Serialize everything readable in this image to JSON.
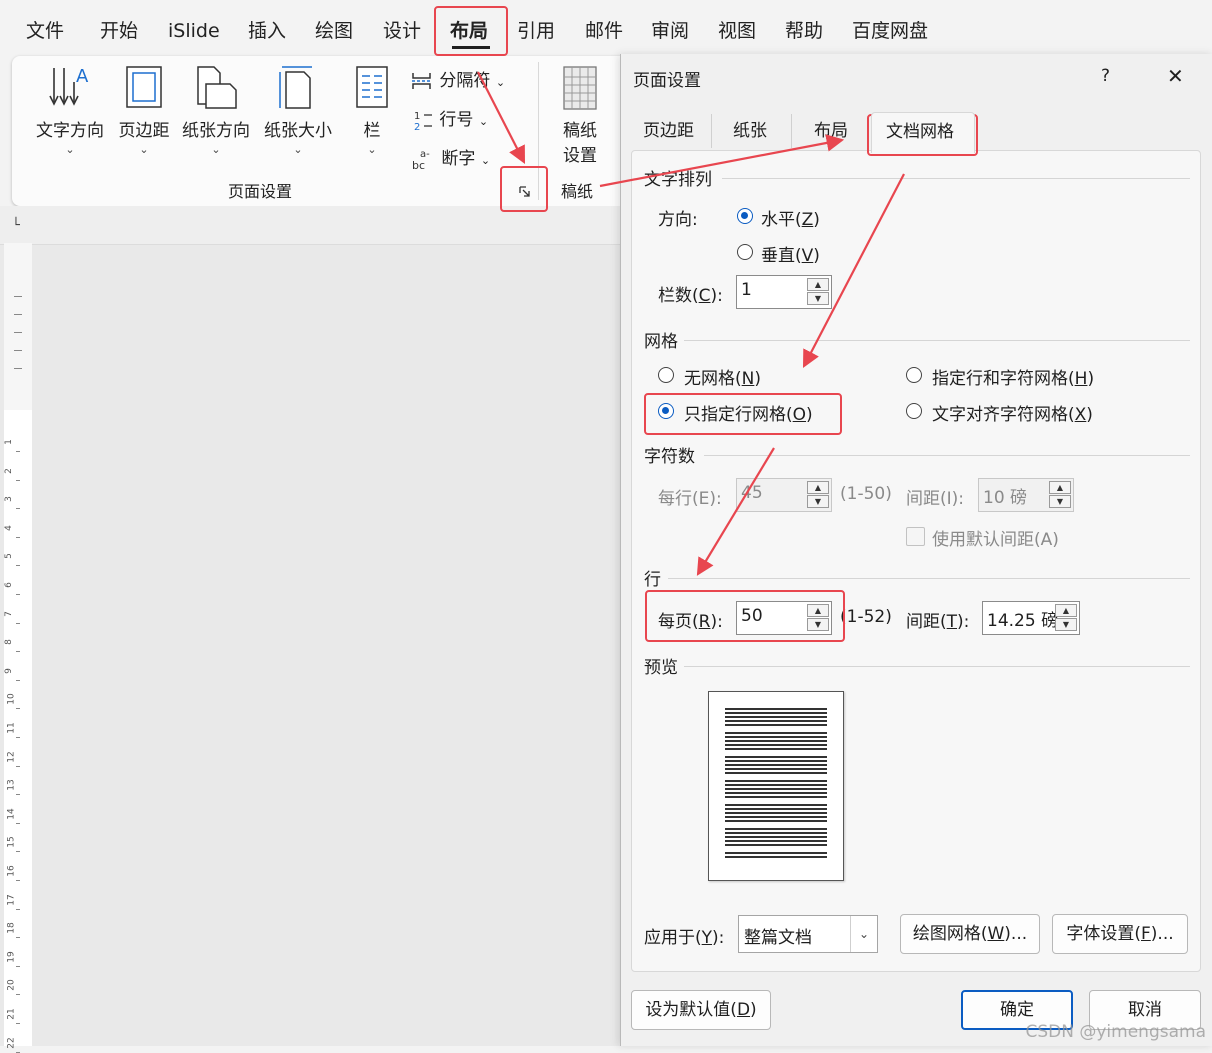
{
  "menu": [
    "文件",
    "开始",
    "iSlide",
    "插入",
    "绘图",
    "设计",
    "布局",
    "引用",
    "邮件",
    "审阅",
    "视图",
    "帮助",
    "百度网盘"
  ],
  "ribbon": {
    "buttons": [
      "文字方向",
      "页边距",
      "纸张方向",
      "纸张大小",
      "栏"
    ],
    "small": [
      "分隔符",
      "行号",
      "断字"
    ],
    "gaozhi_line1": "稿纸",
    "gaozhi_line2": "设置",
    "group_label": "页面设置",
    "group_label2": "稿纸"
  },
  "dialog": {
    "title": "页面设置",
    "help": "?",
    "close": "✕",
    "tabs": [
      "页边距",
      "纸张",
      "布局",
      "文档网格"
    ],
    "text_arrangement": {
      "heading": "文字排列",
      "direction_label": "方向:",
      "horizontal_pre": "水平(",
      "horizontal_key": "Z",
      "post": ")",
      "vertical_pre": "垂直(",
      "vertical_key": "V",
      "columns_pre": "栏数(",
      "columns_key": "C",
      "columns_post": "):",
      "columns_value": "1"
    },
    "grid": {
      "heading": "网格",
      "none_pre": "无网格(",
      "none_key": "N",
      "lines_only_pre": "只指定行网格(",
      "lines_only_key": "O",
      "lines_chars_pre": "指定行和字符网格(",
      "lines_chars_key": "H",
      "snap_pre": "文字对齐字符网格(",
      "snap_key": "X"
    },
    "characters": {
      "heading": "字符数",
      "per_line": "每行(E):",
      "per_line_value": "45",
      "per_line_range": "(1-50)",
      "pitch": "间距(I):",
      "pitch_value": "10 磅",
      "use_default": "使用默认间距(A)"
    },
    "lines": {
      "heading": "行",
      "per_page_pre": "每页(",
      "per_page_key": "R",
      "per_page_post": "):",
      "per_page_value": "50",
      "range": "(1-52)",
      "pitch_pre": "间距(",
      "pitch_key": "T",
      "pitch_post": "):",
      "pitch_value": "14.25 磅"
    },
    "preview_label": "预览",
    "apply_pre": "应用于(",
    "apply_key": "Y",
    "apply_post": "):",
    "apply_value": "整篇文档",
    "draw_grid_pre": "绘图网格(",
    "draw_grid_key": "W",
    "draw_grid_post": ")...",
    "font_settings_pre": "字体设置(",
    "font_settings_key": "F",
    "font_settings_post": ")...",
    "set_default_pre": "设为默认值(",
    "set_default_key": "D",
    "set_default_post": ")",
    "ok": "确定",
    "cancel": "取消"
  },
  "ruler_numbers": [
    "1",
    "2",
    "3",
    "4",
    "5",
    "6",
    "7",
    "8",
    "9",
    "10",
    "11",
    "12",
    "13",
    "14",
    "15",
    "16",
    "17",
    "18",
    "19",
    "20",
    "21",
    "22"
  ],
  "watermark": "CSDN @yimengsama",
  "colors": {
    "highlight": "#e8464f",
    "accent": "#0b5cc2"
  },
  "icons": [
    "text-direction-icon",
    "margins-icon",
    "orientation-icon",
    "paper-size-icon",
    "columns-icon",
    "breaks-icon",
    "line-numbers-icon",
    "hyphenation-icon",
    "manuscript-icon",
    "dialog-launcher-icon"
  ]
}
